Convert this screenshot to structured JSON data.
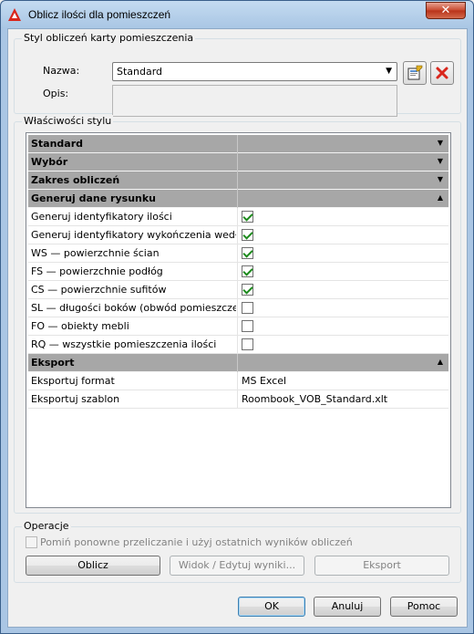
{
  "window": {
    "title": "Oblicz ilości dla pomieszczeń",
    "close_glyph": "✕"
  },
  "style_group": {
    "label": "Styl obliczeń karty pomieszczenia",
    "name_label": "Nazwa:",
    "name_value": "Standard",
    "desc_label": "Opis:",
    "desc_value": ""
  },
  "props_group": {
    "label": "Właściwości stylu",
    "rows": [
      {
        "type": "category",
        "name": "Standard",
        "toggle": "▼"
      },
      {
        "type": "category",
        "name": "Wybór",
        "toggle": "▼"
      },
      {
        "type": "category",
        "name": "Zakres obliczeń",
        "toggle": "▼"
      },
      {
        "type": "category",
        "name": "Generuj dane rysunku",
        "toggle": "▲"
      },
      {
        "type": "check",
        "name": "Generuj identyfikatory ilości",
        "checked": true
      },
      {
        "type": "check",
        "name": "Generuj identyfikatory wykończenia wedłu",
        "checked": true
      },
      {
        "type": "check",
        "name": "WS — powierzchnie ścian",
        "checked": true
      },
      {
        "type": "check",
        "name": "FS — powierzchnie podłóg",
        "checked": true
      },
      {
        "type": "check",
        "name": "CS — powierzchnie sufitów",
        "checked": true
      },
      {
        "type": "check",
        "name": "SL — długości boków (obwód pomieszczer",
        "checked": false
      },
      {
        "type": "check",
        "name": "FO — obiekty mebli",
        "checked": false
      },
      {
        "type": "check",
        "name": "RQ — wszystkie pomieszczenia ilości",
        "checked": false
      },
      {
        "type": "category",
        "name": "Eksport",
        "toggle": "▲"
      },
      {
        "type": "value",
        "name": "Eksportuj format",
        "value": "MS Excel"
      },
      {
        "type": "value",
        "name": "Eksportuj szablon",
        "value": "Roombook_VOB_Standard.xlt"
      }
    ]
  },
  "operations": {
    "label": "Operacje",
    "skip_label": "Pomiń ponowne przeliczanie i użyj ostatnich wyników obliczeń",
    "calc_button": "Oblicz",
    "view_button": "Widok / Edytuj wyniki...",
    "export_button": "Eksport"
  },
  "footer": {
    "ok": "OK",
    "cancel": "Anuluj",
    "help": "Pomoc"
  },
  "colors": {
    "accent_red": "#d9261c",
    "check_green": "#1d8a1d",
    "category_bg": "#a7a7a7"
  }
}
